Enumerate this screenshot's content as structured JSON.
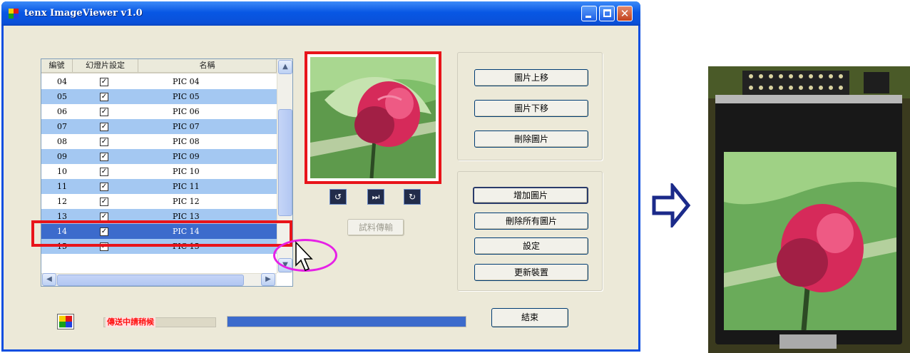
{
  "window": {
    "title": "tenx ImageViewer v1.0",
    "minimize_glyph": "",
    "close_glyph": "✕"
  },
  "list": {
    "headers": [
      "編號",
      "幻燈片設定",
      "名稱"
    ],
    "rows": [
      {
        "num": "04",
        "checked": "✓",
        "name": "PIC 04"
      },
      {
        "num": "05",
        "checked": "✓",
        "name": "PIC 05"
      },
      {
        "num": "06",
        "checked": "✓",
        "name": "PIC 06"
      },
      {
        "num": "07",
        "checked": "✓",
        "name": "PIC 07"
      },
      {
        "num": "08",
        "checked": "✓",
        "name": "PIC 08"
      },
      {
        "num": "09",
        "checked": "✓",
        "name": "PIC 09"
      },
      {
        "num": "10",
        "checked": "✓",
        "name": "PIC 10"
      },
      {
        "num": "11",
        "checked": "✓",
        "name": "PIC 11"
      },
      {
        "num": "12",
        "checked": "✓",
        "name": "PIC 12"
      },
      {
        "num": "13",
        "checked": "✓",
        "name": "PIC 13"
      },
      {
        "num": "14",
        "checked": "✓",
        "name": "PIC 14"
      },
      {
        "num": "15",
        "checked": "✓",
        "name": "PIC 15"
      }
    ],
    "selected_row": "14",
    "scroll_up_glyph": "▲",
    "scroll_down_glyph": "▼",
    "scroll_left_glyph": "◀",
    "scroll_right_glyph": "▶"
  },
  "preview": {
    "controls": [
      {
        "name": "rotate-left",
        "glyph": "↺"
      },
      {
        "name": "next",
        "glyph": "⏭"
      },
      {
        "name": "rotate-right",
        "glyph": "↻"
      }
    ],
    "transfer_label": "試料傳輸"
  },
  "buttons": {
    "move_up": "圖片上移",
    "move_down": "圖片下移",
    "delete": "刪除圖片",
    "add": "增加圖片",
    "remove_all": "刪除所有圖片",
    "settings": "設定",
    "update_device": "更新裝置",
    "exit": "結束"
  },
  "status": {
    "label": "傳送中請稍候",
    "progress": 1.0
  },
  "colors": {
    "selection": "#3c6bcc",
    "highlight_red": "#e8141a",
    "highlight_pink": "#e620e6",
    "alt_row": "#a4c8f2",
    "arrow": "#1b2a8a"
  }
}
